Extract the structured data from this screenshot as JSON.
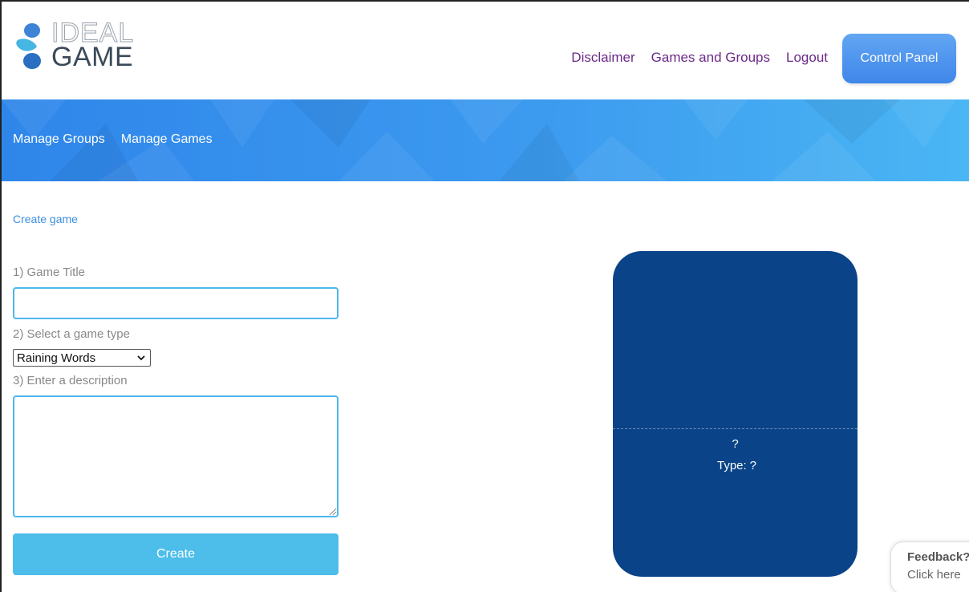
{
  "header": {
    "logo_top": "IDEAL",
    "logo_bottom": "GAME",
    "nav": [
      "Disclaimer",
      "Games and Groups",
      "Logout"
    ],
    "control_panel_label": "Control Panel"
  },
  "banner": {
    "links": [
      "Manage Groups",
      "Manage Games"
    ]
  },
  "form": {
    "create_link": "Create game",
    "title_label": "1) Game Title",
    "title_value": "",
    "type_label": "2) Select a game type",
    "type_selected": "Raining Words",
    "description_label": "3) Enter a description",
    "description_value": "",
    "create_button": "Create"
  },
  "preview": {
    "title": "?",
    "type_label": "Type:",
    "type_value": "?"
  },
  "feedback": {
    "title": "Feedback?",
    "subtitle": "Click here"
  },
  "colors": {
    "nav_link": "#6b2a8a",
    "banner_start": "#2f86ea",
    "banner_end": "#4ab6f4",
    "card": "#0a4388",
    "create_button": "#4dbde9",
    "input_border": "#4ab8ec",
    "logo_drops": [
      "#3e84d6",
      "#46b6e3",
      "#2a6fc2"
    ]
  },
  "icons": [
    "water-drops-logo-icon",
    "chevron-down-icon",
    "resize-grip-icon"
  ]
}
